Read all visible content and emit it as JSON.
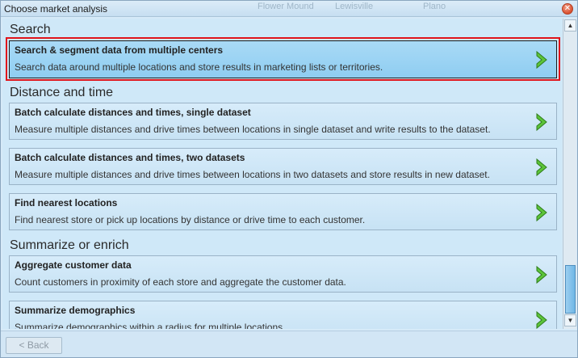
{
  "window": {
    "title": "Choose market analysis",
    "close_icon": "close-icon",
    "map_labels": [
      "Flower Mound",
      "Lewisville",
      "Plano"
    ]
  },
  "sections": [
    {
      "header": "Search",
      "items": [
        {
          "title": "Search & segment data from multiple centers",
          "description": "Search data around multiple locations and store results in marketing lists or territories.",
          "selected": true
        }
      ]
    },
    {
      "header": "Distance and time",
      "items": [
        {
          "title": "Batch calculate distances and times, single dataset",
          "description": "Measure multiple distances and drive times between locations in single dataset and write results to the dataset."
        },
        {
          "title": "Batch calculate distances and times, two datasets",
          "description": "Measure multiple distances and drive times between locations in two datasets and store results in new dataset."
        },
        {
          "title": "Find nearest locations",
          "description": "Find nearest store or pick up locations by distance or drive time to each customer."
        }
      ]
    },
    {
      "header": "Summarize or enrich",
      "items": [
        {
          "title": "Aggregate customer data",
          "description": "Count customers in proximity of each store and aggregate the customer data."
        },
        {
          "title": "Summarize demographics",
          "description": "Summarize demographics within a radius for multiple locations."
        }
      ]
    }
  ],
  "footer": {
    "back_label": "< Back"
  },
  "colors": {
    "selected_bg": "#8fcdf1",
    "selection_outline": "#e0141b",
    "arrow_green": "#4db82c"
  }
}
